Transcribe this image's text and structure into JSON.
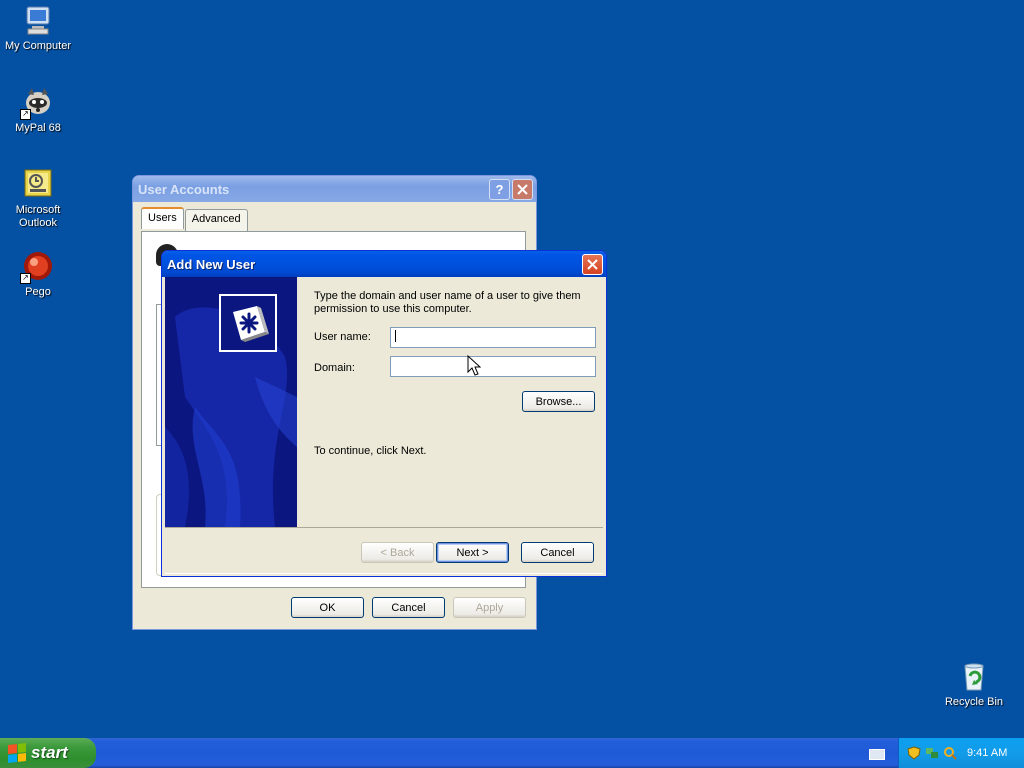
{
  "desktop": {
    "icons": [
      {
        "label": "My Computer",
        "icon": "my-computer-icon"
      },
      {
        "label": "MyPal 68",
        "icon": "mypal-icon"
      },
      {
        "label": "Microsoft Outlook",
        "icon": "outlook-icon"
      },
      {
        "label": "Pego",
        "icon": "pego-icon"
      },
      {
        "label": "Recycle Bin",
        "icon": "recycle-bin-icon"
      }
    ]
  },
  "user_accounts": {
    "title": "User Accounts",
    "tabs": [
      "Users",
      "Advanced"
    ],
    "buttons": {
      "ok": "OK",
      "cancel": "Cancel",
      "apply": "Apply"
    }
  },
  "add_new_user": {
    "title": "Add New User",
    "instruction": "Type the domain and user name of a user to give them permission to use this computer.",
    "username_label": "User name:",
    "username_value": "",
    "domain_label": "Domain:",
    "domain_value": "",
    "browse_label": "Browse...",
    "continue_text": "To continue, click Next.",
    "back_label": "< Back",
    "next_label": "Next >",
    "cancel_label": "Cancel"
  },
  "taskbar": {
    "start_label": "start",
    "clock": "9:41 AM"
  },
  "colors": {
    "desktop": "#0451a4",
    "titlebar_active": "#0055e5",
    "start_green": "#3c9a3c"
  }
}
